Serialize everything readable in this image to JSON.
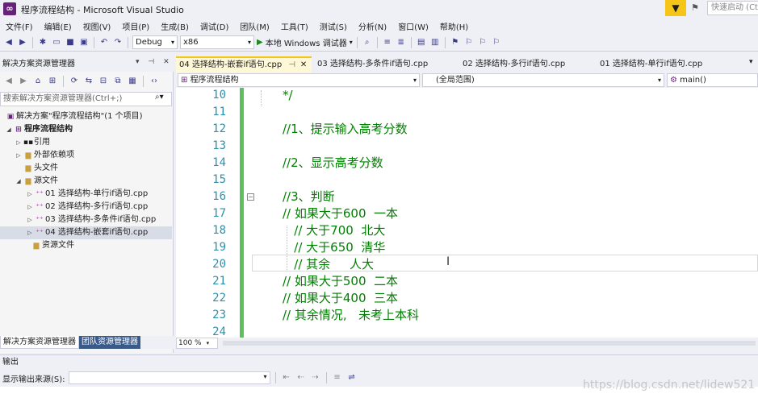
{
  "window": {
    "title": "程序流程结构 - Microsoft Visual Studio",
    "quick_launch_placeholder": "快速启动 (Ct"
  },
  "menu": [
    "文件(F)",
    "编辑(E)",
    "视图(V)",
    "项目(P)",
    "生成(B)",
    "调试(D)",
    "团队(M)",
    "工具(T)",
    "测试(S)",
    "分析(N)",
    "窗口(W)",
    "帮助(H)"
  ],
  "toolbar": {
    "configuration": "Debug",
    "platform": "x86",
    "run_label": "本地 Windows 调试器"
  },
  "solution_explorer": {
    "title": "解决方案资源管理器",
    "search_placeholder": "搜索解决方案资源管理器(Ctrl+;)",
    "solution": "解决方案\"程序流程结构\"(1 个项目)",
    "project": "程序流程结构",
    "nodes": {
      "references": "引用",
      "external_deps": "外部依赖项",
      "header_files": "头文件",
      "source_files": "源文件",
      "resource_files": "资源文件"
    },
    "files": [
      "01 选择结构-单行if语句.cpp",
      "02 选择结构-多行if语句.cpp",
      "03 选择结构-多条件if语句.cpp",
      "04 选择结构-嵌套if语句.cpp"
    ],
    "tabs": [
      "解决方案资源管理器",
      "团队资源管理器"
    ]
  },
  "editor": {
    "tabs": [
      "04 选择结构-嵌套if语句.cpp",
      "03 选择结构-多条件if语句.cpp",
      "02 选择结构-多行if语句.cpp",
      "01 选择结构-单行if语句.cpp"
    ],
    "nav": {
      "project": "程序流程结构",
      "scope": "(全局范围)",
      "member": "main()"
    },
    "lines": [
      {
        "num": "10",
        "text": "*/"
      },
      {
        "num": "11",
        "text": ""
      },
      {
        "num": "12",
        "text": "//1、提示输入高考分数"
      },
      {
        "num": "13",
        "text": ""
      },
      {
        "num": "14",
        "text": "//2、显示高考分数"
      },
      {
        "num": "15",
        "text": ""
      },
      {
        "num": "16",
        "text": "//3、判断"
      },
      {
        "num": "17",
        "text": "// 如果大于600  一本"
      },
      {
        "num": "18",
        "text": "   // 大于700  北大"
      },
      {
        "num": "19",
        "text": "   // 大于650  清华"
      },
      {
        "num": "20",
        "text": "   // 其余     人大"
      },
      {
        "num": "21",
        "text": "// 如果大于500  二本"
      },
      {
        "num": "22",
        "text": "// 如果大于400  三本"
      },
      {
        "num": "23",
        "text": "// 其余情况,   未考上本科"
      },
      {
        "num": "24",
        "text": ""
      }
    ],
    "zoom": "100 %"
  },
  "output": {
    "title": "输出",
    "source_label": "显示输出来源(S):"
  },
  "watermark": "https://blog.csdn.net/lidew521"
}
